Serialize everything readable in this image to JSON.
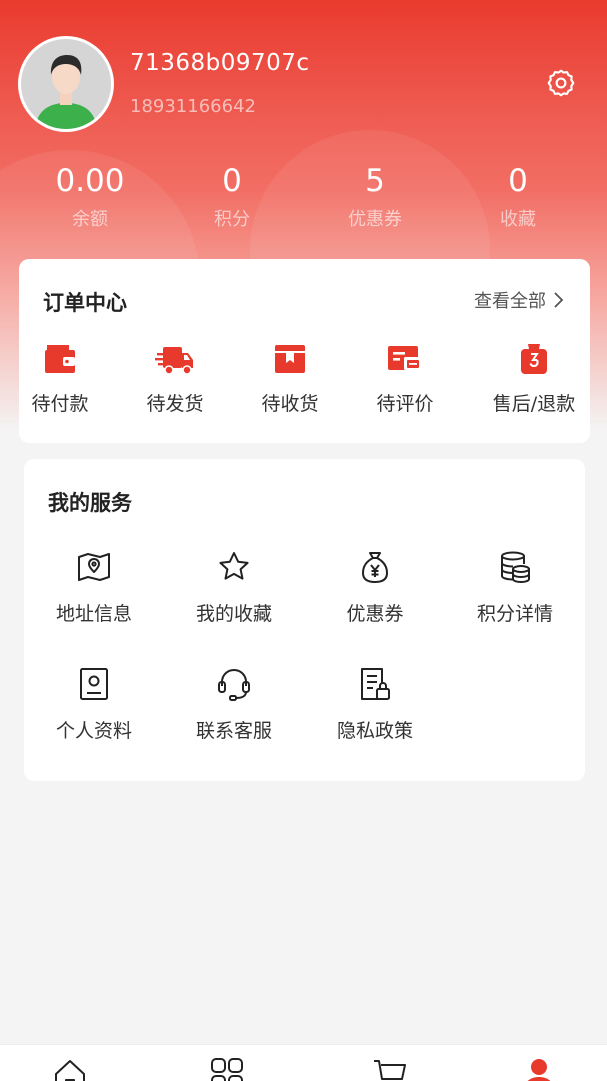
{
  "profile": {
    "username": "71368b09707c",
    "phone": "18931166642"
  },
  "stats": [
    {
      "value": "0.00",
      "label": "余额"
    },
    {
      "value": "0",
      "label": "积分"
    },
    {
      "value": "5",
      "label": "优惠券"
    },
    {
      "value": "0",
      "label": "收藏"
    }
  ],
  "orders": {
    "title": "订单中心",
    "view_all": "查看全部",
    "items": [
      {
        "label": "待付款",
        "icon": "wallet-icon"
      },
      {
        "label": "待发货",
        "icon": "truck-icon"
      },
      {
        "label": "待收货",
        "icon": "box-icon"
      },
      {
        "label": "待评价",
        "icon": "review-icon"
      },
      {
        "label": "售后/退款",
        "icon": "refund-bag-icon"
      }
    ]
  },
  "services": {
    "title": "我的服务",
    "items": [
      {
        "label": "地址信息",
        "icon": "map-pin-icon"
      },
      {
        "label": "我的收藏",
        "icon": "star-icon"
      },
      {
        "label": "优惠券",
        "icon": "money-bag-icon"
      },
      {
        "label": "积分详情",
        "icon": "coins-icon"
      },
      {
        "label": "个人资料",
        "icon": "profile-card-icon"
      },
      {
        "label": "联系客服",
        "icon": "headset-icon"
      },
      {
        "label": "隐私政策",
        "icon": "privacy-doc-icon"
      }
    ]
  },
  "tabbar": {
    "items": [
      {
        "icon": "home-icon"
      },
      {
        "icon": "category-icon"
      },
      {
        "icon": "cart-icon"
      },
      {
        "icon": "user-icon"
      }
    ],
    "active_color": "#e8392d"
  },
  "colors": {
    "brand": "#e8392d",
    "icon_dark": "#222222"
  }
}
